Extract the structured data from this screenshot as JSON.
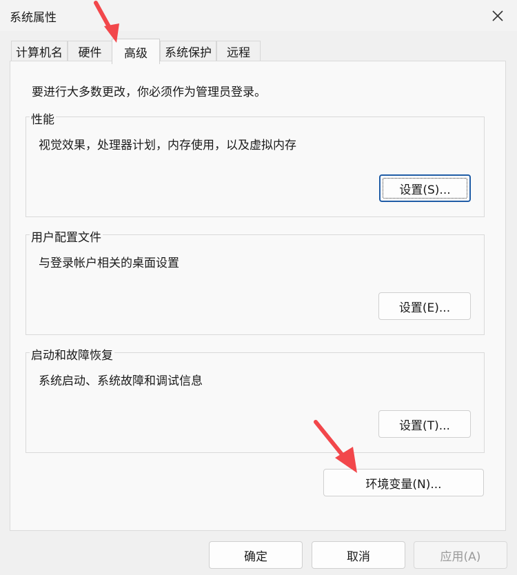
{
  "window": {
    "title": "系统属性"
  },
  "tabs": [
    {
      "label": "计算机名"
    },
    {
      "label": "硬件"
    },
    {
      "label": "高级"
    },
    {
      "label": "系统保护"
    },
    {
      "label": "远程"
    }
  ],
  "notice": "要进行大多数更改，你必须作为管理员登录。",
  "groups": {
    "performance": {
      "title": "性能",
      "desc": "视觉效果，处理器计划，内存使用，以及虚拟内存",
      "button": "设置(S)..."
    },
    "profiles": {
      "title": "用户配置文件",
      "desc": "与登录帐户相关的桌面设置",
      "button": "设置(E)..."
    },
    "startup": {
      "title": "启动和故障恢复",
      "desc": "系统启动、系统故障和调试信息",
      "button": "设置(T)..."
    }
  },
  "env_button": "环境变量(N)...",
  "footer": {
    "ok": "确定",
    "cancel": "取消",
    "apply": "应用(A)"
  },
  "colors": {
    "annotation_arrow": "#f2474b",
    "focus_border": "#1f5ca6"
  },
  "icons": {
    "close": "close-icon",
    "annotation": "arrow-annotation"
  }
}
